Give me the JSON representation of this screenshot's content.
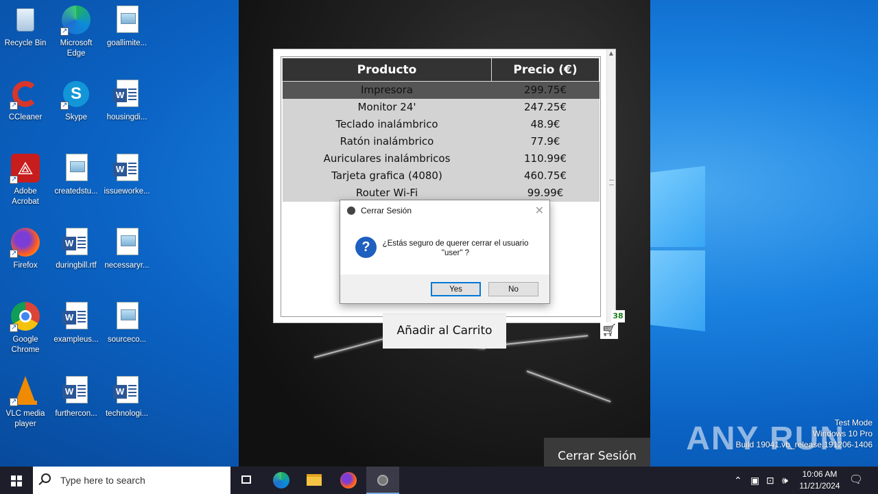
{
  "desktop": {
    "icons": [
      {
        "label": "Recycle Bin",
        "icon": "recycle-bin-icon"
      },
      {
        "label": "Microsoft Edge",
        "icon": "edge-icon"
      },
      {
        "label": "goallimite...",
        "icon": "image-file-icon"
      },
      {
        "label": "CCleaner",
        "icon": "ccleaner-icon"
      },
      {
        "label": "Skype",
        "icon": "skype-icon"
      },
      {
        "label": "housingdi...",
        "icon": "word-doc-icon"
      },
      {
        "label": "Adobe Acrobat",
        "icon": "acrobat-icon"
      },
      {
        "label": "createdstu...",
        "icon": "image-file-icon"
      },
      {
        "label": "issueworke...",
        "icon": "word-doc-icon"
      },
      {
        "label": "Firefox",
        "icon": "firefox-icon"
      },
      {
        "label": "duringbill.rtf",
        "icon": "word-doc-icon"
      },
      {
        "label": "necessaryr...",
        "icon": "image-file-icon"
      },
      {
        "label": "Google Chrome",
        "icon": "chrome-icon"
      },
      {
        "label": "exampleus...",
        "icon": "word-doc-icon"
      },
      {
        "label": "sourceco...",
        "icon": "image-file-icon"
      },
      {
        "label": "VLC media player",
        "icon": "vlc-icon"
      },
      {
        "label": "furthercon...",
        "icon": "word-doc-icon"
      },
      {
        "label": "technologi...",
        "icon": "word-doc-icon"
      }
    ]
  },
  "app": {
    "table": {
      "headers": [
        "Producto",
        "Precio (€)"
      ],
      "rows": [
        {
          "product": "Impresora",
          "price": "299.75€",
          "selected": true
        },
        {
          "product": "Monitor 24'",
          "price": "247.25€"
        },
        {
          "product": "Teclado inalámbrico",
          "price": "48.9€"
        },
        {
          "product": "Ratón inalámbrico",
          "price": "77.9€"
        },
        {
          "product": "Auriculares inalámbricos",
          "price": "110.99€"
        },
        {
          "product": "Tarjeta grafica (4080)",
          "price": "460.75€"
        },
        {
          "product": "Router Wi-Fi",
          "price": "99.99€"
        }
      ]
    },
    "add_to_cart_label": "Añadir al Carrito",
    "cart_count": "38",
    "logout_label": "Cerrar Sesión"
  },
  "dialog": {
    "title": "Cerrar Sesión",
    "message": "¿Estás seguro de querer cerrar el usuario \"user\"  ?",
    "yes_label": "Yes",
    "no_label": "No"
  },
  "watermark": {
    "brand": "ANY RUN",
    "line1": "Test Mode",
    "line2": "Windows 10 Pro",
    "line3": "Build 19041.vb_release.191206-1406"
  },
  "taskbar": {
    "search_placeholder": "Type here to search",
    "time": "10:06 AM",
    "date": "11/21/2024"
  },
  "colors": {
    "desktop_blue": "#0b63c4",
    "table_header": "#333333",
    "row_bg": "#d3d3d3",
    "selected_row": "#555555",
    "cart_count_green": "#1a7a1a",
    "dialog_accent": "#0078d7"
  }
}
